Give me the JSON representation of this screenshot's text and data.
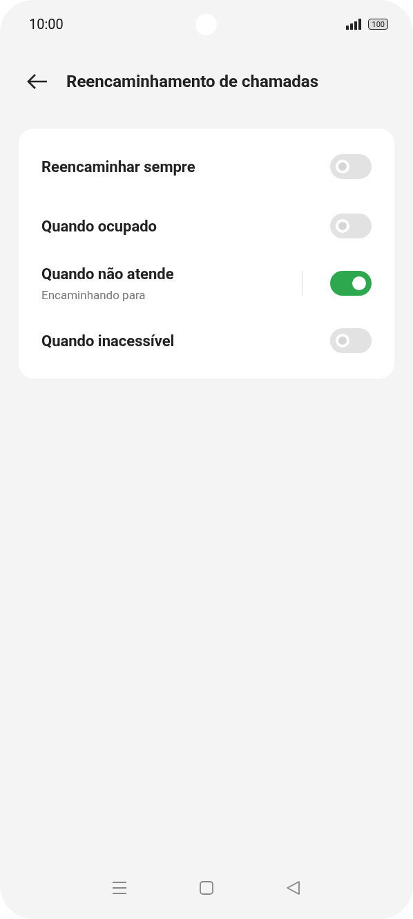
{
  "status_bar": {
    "time": "10:00",
    "battery": "100"
  },
  "header": {
    "title": "Reencaminhamento de chamadas"
  },
  "settings": [
    {
      "label": "Reencaminhar sempre",
      "on": false
    },
    {
      "label": "Quando ocupado",
      "on": false
    },
    {
      "label": "Quando não atende",
      "subtitle": "Encaminhando para",
      "on": true
    },
    {
      "label": "Quando inacessível",
      "on": false
    }
  ]
}
